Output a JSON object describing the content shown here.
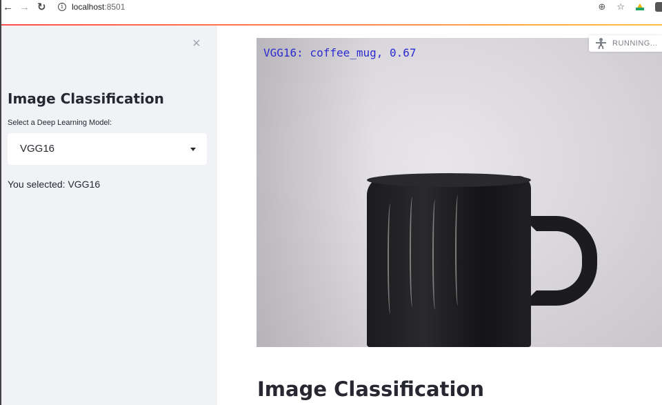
{
  "browser": {
    "url_host": "localhost",
    "url_port": ":8501",
    "icons": [
      "back-arrow-icon",
      "forward-arrow-icon",
      "reload-icon",
      "info-icon",
      "zoom-icon",
      "star-icon",
      "drive-icon",
      "extension-icon"
    ]
  },
  "sidebar": {
    "title": "Image Classification",
    "select_label": "Select a Deep Learning Model:",
    "select_value": "VGG16",
    "selected_text": "You selected: VGG16",
    "close_glyph": "×"
  },
  "main": {
    "status": "RUNNING...",
    "overlay_text": "VGG16: coffee_mug, 0.67",
    "title": "Image Classification"
  },
  "colors": {
    "accent_gradient_start": "#ff4b4b",
    "accent_gradient_end": "#ffbd45",
    "overlay_text": "#2b2bd0",
    "sidebar_bg": "#f0f2f6"
  }
}
